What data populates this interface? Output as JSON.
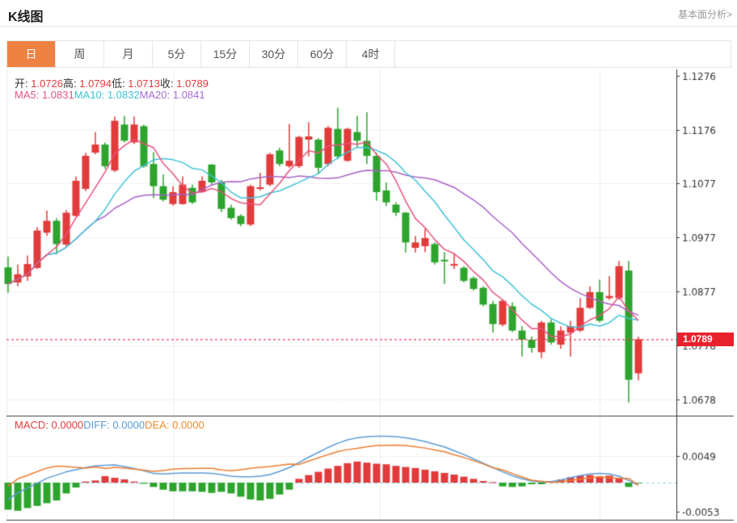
{
  "header": {
    "title": "K线图",
    "link": "基本面分析>"
  },
  "tabs": {
    "active": "日",
    "items": [
      "日",
      "周",
      "月",
      "5分",
      "15分",
      "30分",
      "60分",
      "4时"
    ]
  },
  "legend": {
    "ohlc": [
      {
        "label": "开:",
        "value": "1.0726"
      },
      {
        "label": "高:",
        "value": "1.0794"
      },
      {
        "label": "低:",
        "value": "1.0713"
      },
      {
        "label": "收:",
        "value": "1.0789"
      }
    ],
    "ma": [
      {
        "label": "MA5:",
        "value": "1.0831",
        "color": "#e0557e"
      },
      {
        "label": "MA10:",
        "value": "1.0832",
        "color": "#3ec4d4"
      },
      {
        "label": "MA20:",
        "value": "1.0841",
        "color": "#a66bd5"
      }
    ],
    "macd": [
      {
        "label": "MACD:",
        "value": "0.0000",
        "color": "#e03c3c"
      },
      {
        "label": "DIFF:",
        "value": "0.0000",
        "color": "#5b9bd5"
      },
      {
        "label": "DEA:",
        "value": "0.0000",
        "color": "#f08c2e"
      }
    ]
  },
  "price_badge": {
    "value": "1.0789"
  },
  "colors": {
    "up": "#e13b3b",
    "down": "#2da42d",
    "ma5": "#e8517a",
    "ma10": "#3fc3d8",
    "ma20": "#a95fc8",
    "diff": "#5b9bd5",
    "dea": "#ed7d31",
    "price_line": "#f5365c",
    "badge_bg": "#e8222d",
    "tab_active": "#ef8142",
    "axis": "#333333",
    "grid": "#f0f0f0",
    "vgrid": "#ececec",
    "zero_line": "#8fd0e8",
    "panel_border": "#3c3c3c"
  },
  "chart_data": {
    "type": "candlestick",
    "panels": [
      "price",
      "macd"
    ],
    "y_axis": {
      "ticks": [
        1.1276,
        1.1176,
        1.1077,
        1.0977,
        1.0877,
        1.0778,
        1.0678
      ],
      "price_line": 1.0789
    },
    "ma_periods": [
      5,
      10,
      20
    ],
    "candles": [
      [
        1.0922,
        1.0942,
        1.0875,
        1.0891
      ],
      [
        1.0894,
        1.0927,
        1.0887,
        1.0909
      ],
      [
        1.0905,
        1.0944,
        1.0897,
        1.0928
      ],
      [
        1.0921,
        1.0996,
        1.0919,
        1.099
      ],
      [
        1.0986,
        1.1027,
        1.098,
        1.1008
      ],
      [
        1.1008,
        1.1013,
        1.0946,
        1.0965
      ],
      [
        1.0964,
        1.1028,
        1.0961,
        1.1023
      ],
      [
        1.1017,
        1.109,
        1.1016,
        1.1082
      ],
      [
        1.1067,
        1.1134,
        1.1063,
        1.1128
      ],
      [
        1.1134,
        1.1172,
        1.1131,
        1.1149
      ],
      [
        1.1149,
        1.1153,
        1.1104,
        1.1109
      ],
      [
        1.1101,
        1.1201,
        1.1098,
        1.1193
      ],
      [
        1.1186,
        1.1202,
        1.1153,
        1.1156
      ],
      [
        1.1153,
        1.1201,
        1.115,
        1.1186
      ],
      [
        1.1183,
        1.1186,
        1.1106,
        1.1109
      ],
      [
        1.1113,
        1.1135,
        1.105,
        1.1072
      ],
      [
        1.1072,
        1.1094,
        1.1044,
        1.1047
      ],
      [
        1.1039,
        1.1072,
        1.1036,
        1.1061
      ],
      [
        1.1039,
        1.109,
        1.1038,
        1.1075
      ],
      [
        1.1069,
        1.1075,
        1.1039,
        1.1042
      ],
      [
        1.1061,
        1.109,
        1.106,
        1.1082
      ],
      [
        1.1112,
        1.1113,
        1.1075,
        1.1079
      ],
      [
        1.1079,
        1.1084,
        1.1024,
        1.103
      ],
      [
        1.1032,
        1.1038,
        1.101,
        1.1013
      ],
      [
        1.1017,
        1.102,
        1.0998,
        1.1002
      ],
      [
        1.1001,
        1.1075,
        1.0998,
        1.1072
      ],
      [
        1.1067,
        1.1097,
        1.1064,
        1.107
      ],
      [
        1.1075,
        1.1134,
        1.1072,
        1.1131
      ],
      [
        1.1138,
        1.1143,
        1.1109,
        1.1113
      ],
      [
        1.1109,
        1.1187,
        1.1106,
        1.1119
      ],
      [
        1.1109,
        1.1165,
        1.1106,
        1.1163
      ],
      [
        1.1158,
        1.119,
        1.1127,
        1.1164
      ],
      [
        1.1158,
        1.1161,
        1.1094,
        1.1106
      ],
      [
        1.1113,
        1.1183,
        1.1109,
        1.118
      ],
      [
        1.1178,
        1.1217,
        1.1122,
        1.1127
      ],
      [
        1.1119,
        1.118,
        1.1117,
        1.1178
      ],
      [
        1.1172,
        1.1202,
        1.1143,
        1.1156
      ],
      [
        1.1156,
        1.1209,
        1.1113,
        1.1128
      ],
      [
        1.1128,
        1.1134,
        1.1045,
        1.1061
      ],
      [
        1.1064,
        1.1079,
        1.1035,
        1.1042
      ],
      [
        1.1038,
        1.1042,
        1.1017,
        1.1023
      ],
      [
        1.1023,
        1.1024,
        1.0949,
        1.0968
      ],
      [
        1.0958,
        1.098,
        1.0949,
        1.0968
      ],
      [
        1.0961,
        1.0993,
        1.095,
        1.0976
      ],
      [
        1.0965,
        1.0968,
        1.0927,
        1.0931
      ],
      [
        1.0936,
        1.095,
        1.0891,
        1.0933
      ],
      [
        1.0925,
        1.0946,
        1.0919,
        1.0928
      ],
      [
        1.0921,
        1.0924,
        1.0894,
        1.0897
      ],
      [
        1.0902,
        1.0905,
        1.0879,
        1.0882
      ],
      [
        1.0884,
        1.0887,
        1.085,
        1.0853
      ],
      [
        1.0854,
        1.086,
        1.0801,
        1.0817
      ],
      [
        1.0816,
        1.0863,
        1.0813,
        1.086
      ],
      [
        1.085,
        1.0857,
        1.0802,
        1.0805
      ],
      [
        1.0805,
        1.0813,
        1.0757,
        1.0788
      ],
      [
        1.0788,
        1.0794,
        1.0764,
        1.0773
      ],
      [
        1.0765,
        1.0823,
        1.0754,
        1.082
      ],
      [
        1.082,
        1.0826,
        1.0779,
        1.0783
      ],
      [
        1.0779,
        1.0813,
        1.0771,
        1.0805
      ],
      [
        1.0801,
        1.0823,
        1.0757,
        1.0813
      ],
      [
        1.0805,
        1.0865,
        1.0802,
        1.0847
      ],
      [
        1.0847,
        1.0887,
        1.0845,
        1.0876
      ],
      [
        1.0876,
        1.0899,
        1.082,
        1.0823
      ],
      [
        1.0865,
        1.0906,
        1.0862,
        1.0869
      ],
      [
        1.0865,
        1.0934,
        1.0862,
        1.0924
      ],
      [
        1.0916,
        1.0934,
        1.0672,
        1.0714
      ],
      [
        1.0726,
        1.0794,
        1.0713,
        1.0789
      ]
    ],
    "macd": {
      "ticks": [
        0.0049,
        -0.0053
      ],
      "hist": [
        -0.005,
        -0.0052,
        -0.0047,
        -0.0043,
        -0.0038,
        -0.0033,
        -0.002,
        -0.0009,
        0.0002,
        0.0004,
        0.0012,
        0.0009,
        0.0006,
        0.0002,
        -0.0002,
        -0.0008,
        -0.0013,
        -0.0016,
        -0.0016,
        -0.0016,
        -0.0017,
        -0.0019,
        -0.0017,
        -0.002,
        -0.0026,
        -0.0031,
        -0.0033,
        -0.003,
        -0.0022,
        -0.0013,
        0.0007,
        0.0014,
        0.002,
        0.0026,
        0.0031,
        0.0036,
        0.0039,
        0.0037,
        0.0035,
        0.0034,
        0.0031,
        0.0029,
        0.0027,
        0.0024,
        0.0021,
        0.0018,
        0.0015,
        0.0011,
        0.0007,
        0.0003,
        0.0001,
        -0.0007,
        -0.0008,
        -0.0007,
        -0.0003,
        -0.0003,
        0.0003,
        0.0006,
        0.001,
        0.0013,
        0.0014,
        0.0012,
        0.0013,
        0.0008,
        -0.0008,
        -0.0001
      ],
      "diff": [
        -0.0031,
        -0.0019,
        -0.001,
        -0.0001,
        0.0008,
        0.0014,
        0.002,
        0.0024,
        0.0028,
        0.0031,
        0.0032,
        0.0033,
        0.003,
        0.0026,
        0.0022,
        0.0017,
        0.0016,
        0.0017,
        0.0018,
        0.0018,
        0.0018,
        0.0017,
        0.0015,
        0.0012,
        0.0011,
        0.0011,
        0.0012,
        0.0015,
        0.0021,
        0.0028,
        0.0037,
        0.0047,
        0.0056,
        0.0065,
        0.0073,
        0.0079,
        0.0083,
        0.0085,
        0.0086,
        0.0086,
        0.0085,
        0.0083,
        0.008,
        0.0076,
        0.0071,
        0.0066,
        0.0059,
        0.0052,
        0.0044,
        0.0036,
        0.0028,
        0.002,
        0.0013,
        0.0007,
        0.0003,
        0.0001,
        0.0002,
        0.0005,
        0.0009,
        0.0013,
        0.0016,
        0.0017,
        0.0016,
        0.0012,
        0.0004,
        -0.0005
      ]
    }
  }
}
